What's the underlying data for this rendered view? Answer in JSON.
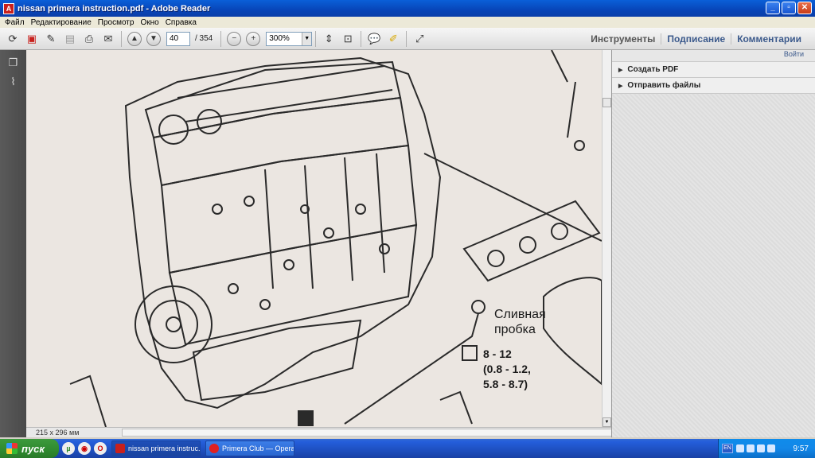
{
  "window": {
    "title": "nissan primera instruction.pdf - Adobe Reader"
  },
  "menu": [
    "Файл",
    "Редактирование",
    "Просмотр",
    "Окно",
    "Справка"
  ],
  "toolbar": {
    "page_current": "40",
    "page_total": "/ 354",
    "zoom": "300%",
    "links": [
      "Инструменты",
      "Подписание",
      "Комментарии"
    ]
  },
  "document": {
    "label_drain": "Сливная",
    "label_plug": "пробка",
    "torque_line1": "8 - 12",
    "torque_line2": "(0.8 - 1.2,",
    "torque_line3": "5.8 - 8.7)"
  },
  "status": {
    "page_size": "215 x 296 мм"
  },
  "side_panel": {
    "sign_in": "Войти",
    "items": [
      "Создать PDF",
      "Отправить файлы"
    ]
  },
  "taskbar": {
    "start": "пуск",
    "tasks": [
      "nissan primera instruc...",
      "Primera Club — Opera"
    ],
    "lang": "EN",
    "clock": "9:57"
  }
}
